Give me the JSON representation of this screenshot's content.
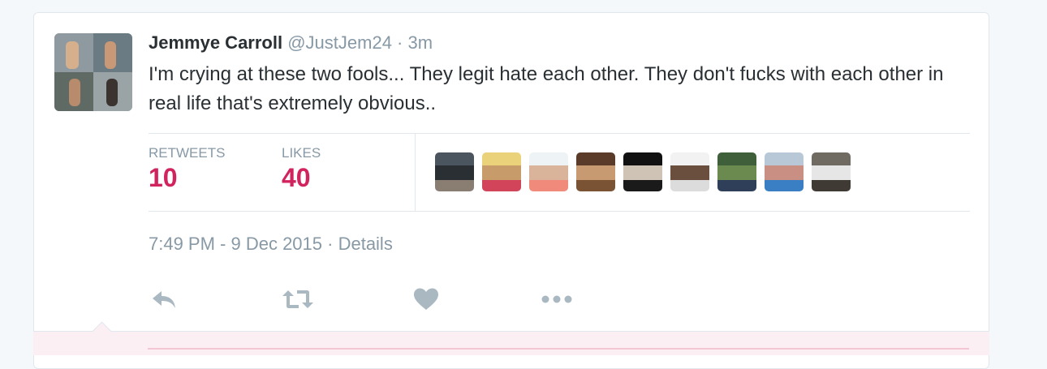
{
  "tweet": {
    "fullname": "Jemmye Carroll",
    "username": "@JustJem24",
    "separator": " · ",
    "time_ago": "3m",
    "text": "I'm crying at these two fools... They legit hate each other. They don't fucks with each other in real life that's extremely obvious..",
    "timestamp": "7:49 PM - 9 Dec 2015",
    "details_sep": " · ",
    "details_link": "Details"
  },
  "stats": {
    "retweets_label": "RETWEETS",
    "retweets_value": "10",
    "likes_label": "LIKES",
    "likes_value": "40"
  },
  "likers": [
    {
      "name": "liker-avatar-1",
      "colors": [
        "#4b5560",
        "#2a2f33",
        "#8a7d72"
      ]
    },
    {
      "name": "liker-avatar-2",
      "colors": [
        "#e9d27a",
        "#c89b6a",
        "#d2445a"
      ]
    },
    {
      "name": "liker-avatar-3",
      "colors": [
        "#eef3f5",
        "#d9b39a",
        "#f08a7a"
      ]
    },
    {
      "name": "liker-avatar-4",
      "colors": [
        "#5a3a28",
        "#c89a72",
        "#7a5234"
      ]
    },
    {
      "name": "liker-avatar-5",
      "colors": [
        "#111111",
        "#cfc3b6",
        "#1a1a1a"
      ]
    },
    {
      "name": "liker-avatar-6",
      "colors": [
        "#f2f2f2",
        "#6b4f3e",
        "#dcdcdc"
      ]
    },
    {
      "name": "liker-avatar-7",
      "colors": [
        "#3f5f3a",
        "#6a8a4f",
        "#2f3f5a"
      ]
    },
    {
      "name": "liker-avatar-8",
      "colors": [
        "#b9c8d6",
        "#c98f82",
        "#3a7fc4"
      ]
    },
    {
      "name": "liker-avatar-9",
      "colors": [
        "#6f6a62",
        "#e6e6e6",
        "#3f3a34"
      ]
    }
  ],
  "colors": {
    "accent_like": "#d1235e",
    "muted": "#8899a6",
    "icon": "#aab8c2"
  },
  "icons": [
    "reply-icon",
    "retweet-icon",
    "like-icon",
    "more-icon"
  ]
}
